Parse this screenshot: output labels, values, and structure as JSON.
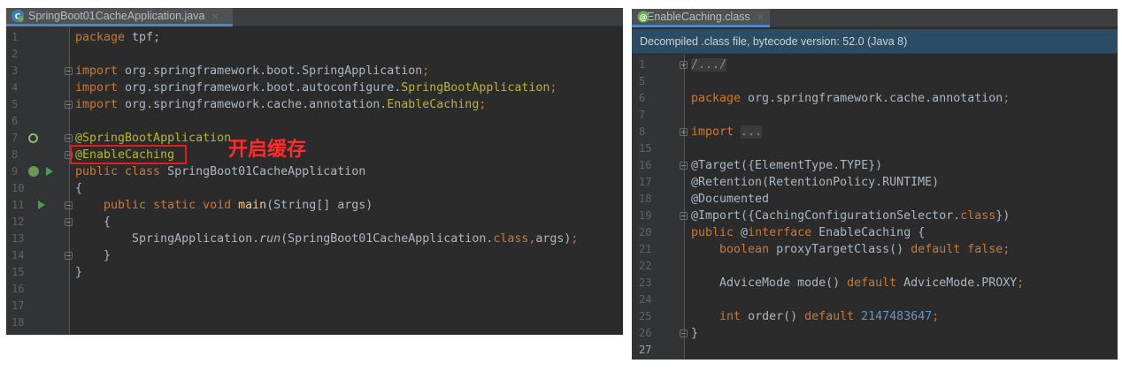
{
  "left_editor": {
    "tab": {
      "title": "SpringBoot01CacheApplication.java",
      "close_glyph": "×",
      "icon": "spring-class-icon"
    },
    "callout": "开启缓存",
    "lines": [
      {
        "n": "1",
        "parts": [
          [
            "kw",
            "package "
          ],
          [
            "plain",
            "tpf;"
          ]
        ]
      },
      {
        "n": "2",
        "parts": []
      },
      {
        "n": "3",
        "parts": [
          [
            "kw",
            "import "
          ],
          [
            "plain",
            "org.springframework.boot.SpringApplication"
          ],
          [
            "kw",
            ";"
          ]
        ]
      },
      {
        "n": "4",
        "parts": [
          [
            "kw",
            "import "
          ],
          [
            "plain",
            "org.springframework.boot.autoconfigure."
          ],
          [
            "ann",
            "SpringBootApplication"
          ],
          [
            "kw",
            ";"
          ]
        ]
      },
      {
        "n": "5",
        "parts": [
          [
            "kw",
            "import "
          ],
          [
            "plain",
            "org.springframework.cache.annotation."
          ],
          [
            "ann",
            "EnableCaching"
          ],
          [
            "kw",
            ";"
          ]
        ]
      },
      {
        "n": "6",
        "parts": []
      },
      {
        "n": "7",
        "parts": [
          [
            "ann",
            "@SpringBootApplication"
          ]
        ]
      },
      {
        "n": "8",
        "parts": [
          [
            "ann",
            "@EnableCaching"
          ]
        ]
      },
      {
        "n": "9",
        "parts": [
          [
            "kw",
            "public class "
          ],
          [
            "plain",
            "SpringBoot01CacheApplication"
          ]
        ]
      },
      {
        "n": "10",
        "parts": [
          [
            "plain",
            "{"
          ]
        ]
      },
      {
        "n": "11",
        "parts": [
          [
            "plain",
            "    "
          ],
          [
            "kw",
            "public static void "
          ],
          [
            "fn",
            "main"
          ],
          [
            "plain",
            "(String[] args)"
          ]
        ]
      },
      {
        "n": "12",
        "parts": [
          [
            "plain",
            "    {"
          ]
        ]
      },
      {
        "n": "13",
        "parts": [
          [
            "plain",
            "        SpringApplication."
          ],
          [
            "it",
            "run"
          ],
          [
            "plain",
            "(SpringBoot01CacheApplication."
          ],
          [
            "kw",
            "class,"
          ],
          [
            "plain",
            "args)"
          ],
          [
            "kw",
            ";"
          ]
        ]
      },
      {
        "n": "14",
        "parts": [
          [
            "plain",
            "    }"
          ]
        ]
      },
      {
        "n": "15",
        "parts": [
          [
            "plain",
            "}"
          ]
        ]
      },
      {
        "n": "16",
        "parts": []
      },
      {
        "n": "17",
        "parts": []
      },
      {
        "n": "18",
        "parts": []
      }
    ]
  },
  "right_editor": {
    "tab": {
      "title": "EnableCaching.class",
      "close_glyph": "×",
      "icon": "annotation-class-icon"
    },
    "banner": "Decompiled .class file, bytecode version: 52.0 (Java 8)",
    "lines": [
      {
        "n": "1",
        "parts": [
          [
            "fold",
            "/.../"
          ]
        ]
      },
      {
        "n": "5",
        "parts": []
      },
      {
        "n": "6",
        "parts": [
          [
            "kw",
            "package "
          ],
          [
            "plain",
            "org.springframework.cache.annotation"
          ],
          [
            "kw",
            ";"
          ]
        ]
      },
      {
        "n": "7",
        "parts": []
      },
      {
        "n": "8",
        "parts": [
          [
            "kw",
            "import "
          ],
          [
            "fold",
            "..."
          ]
        ]
      },
      {
        "n": "15",
        "parts": []
      },
      {
        "n": "16",
        "parts": [
          [
            "plain",
            "@Target({ElementType.TYPE})"
          ]
        ]
      },
      {
        "n": "17",
        "parts": [
          [
            "plain",
            "@Retention(RetentionPolicy.RUNTIME)"
          ]
        ]
      },
      {
        "n": "18",
        "parts": [
          [
            "plain",
            "@Documented"
          ]
        ]
      },
      {
        "n": "19",
        "parts": [
          [
            "plain",
            "@Import({CachingConfigurationSelector."
          ],
          [
            "kw",
            "class"
          ],
          [
            "plain",
            "})"
          ]
        ]
      },
      {
        "n": "20",
        "parts": [
          [
            "kw",
            "public "
          ],
          [
            "plain",
            "@"
          ],
          [
            "kw",
            "interface "
          ],
          [
            "plain",
            "EnableCaching {"
          ]
        ]
      },
      {
        "n": "21",
        "parts": [
          [
            "plain",
            "    "
          ],
          [
            "kw",
            "boolean "
          ],
          [
            "plain",
            "proxyTargetClass() "
          ],
          [
            "kw",
            "default false;"
          ]
        ]
      },
      {
        "n": "22",
        "parts": []
      },
      {
        "n": "23",
        "parts": [
          [
            "plain",
            "    AdviceMode mode() "
          ],
          [
            "kw",
            "default "
          ],
          [
            "plain",
            "AdviceMode.PROXY"
          ],
          [
            "kw",
            ";"
          ]
        ]
      },
      {
        "n": "24",
        "parts": []
      },
      {
        "n": "25",
        "parts": [
          [
            "plain",
            "    "
          ],
          [
            "kw",
            "int "
          ],
          [
            "plain",
            "order() "
          ],
          [
            "kw",
            "default "
          ],
          [
            "num",
            "2147483647"
          ],
          [
            "kw",
            ";"
          ]
        ]
      },
      {
        "n": "26",
        "parts": [
          [
            "plain",
            "}"
          ]
        ]
      },
      {
        "n": "27",
        "parts": []
      }
    ]
  },
  "colors": {
    "editor_bg": "#2b2b2b",
    "keyword": "#cc7832",
    "annotation": "#bbb529",
    "number": "#6897bb",
    "method": "#ffc66d",
    "plain": "#a9b7c6",
    "callout_red": "#ff2a2a"
  }
}
